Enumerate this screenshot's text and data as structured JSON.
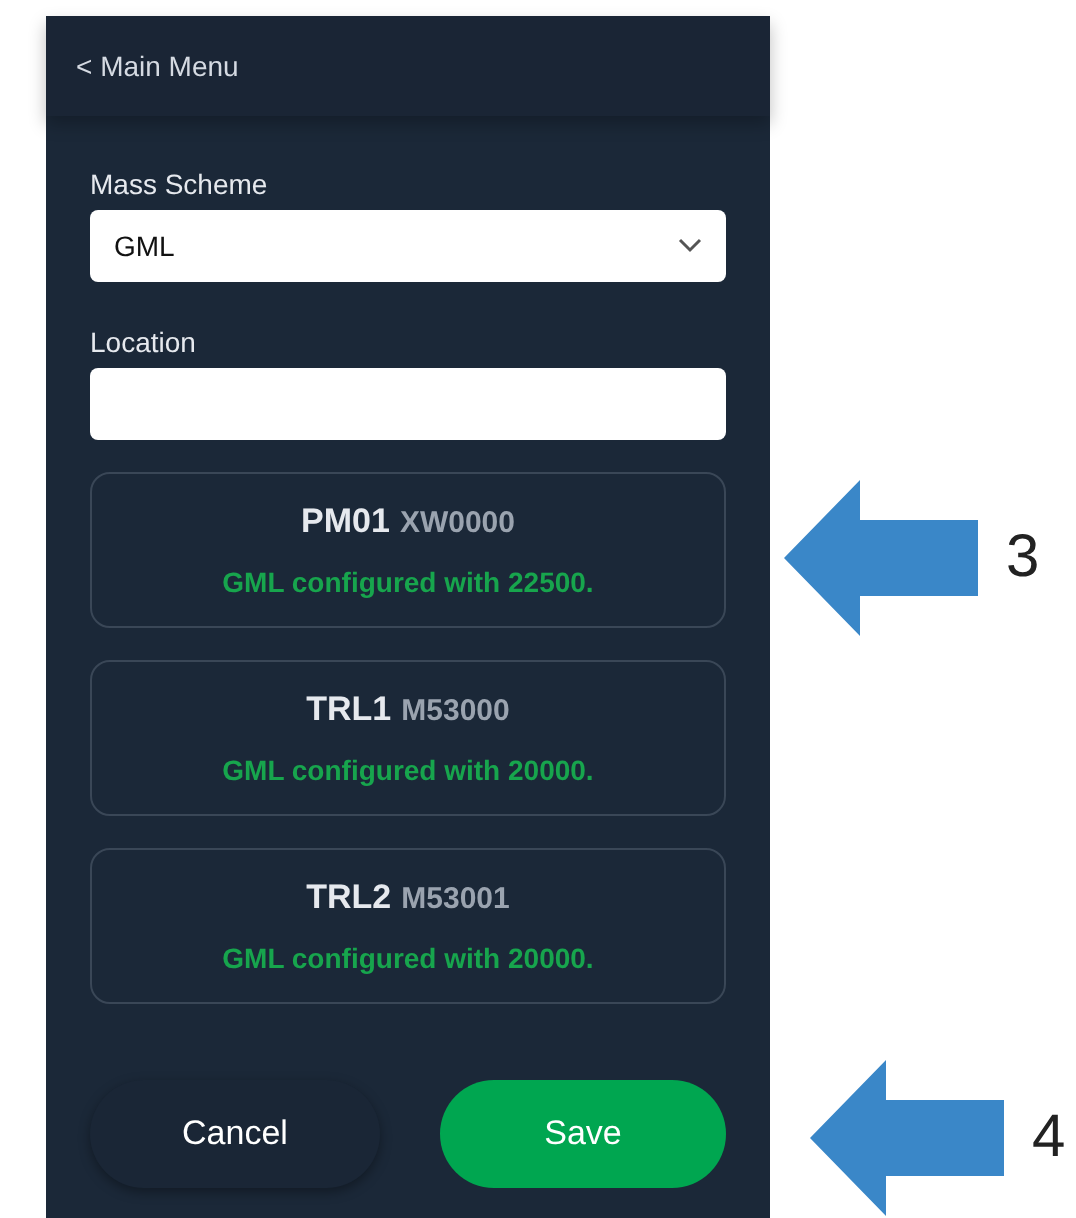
{
  "header": {
    "back_link": "< Main Menu"
  },
  "fields": [
    {
      "kind": "select",
      "label": "Mass Scheme",
      "value": "GML"
    },
    {
      "kind": "text",
      "label": "Location"
    }
  ],
  "vehicles": [
    {
      "name": "PM01",
      "id": "XW0000",
      "status": "GML configured with 22500."
    },
    {
      "name": "TRL1",
      "id": "M53000",
      "status": "GML configured with 20000."
    },
    {
      "name": "TRL2",
      "id": "M53001",
      "status": "GML configured with 20000."
    }
  ],
  "buttons": [
    {
      "kind": "secondary",
      "label": "Cancel"
    },
    {
      "kind": "primary",
      "label": "Save"
    }
  ],
  "annotations": [
    {
      "label": "3"
    },
    {
      "label": "4"
    }
  ]
}
